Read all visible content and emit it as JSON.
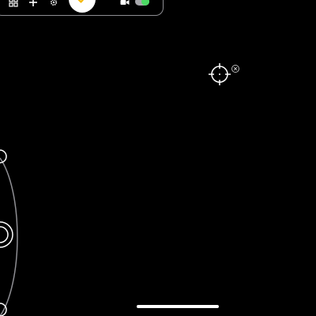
{
  "toolbar": {
    "items": [
      {
        "icon": "grid-icon"
      },
      {
        "icon": "plus-icon"
      },
      {
        "icon": "gear-icon"
      },
      {
        "icon": "checkmark-icon"
      },
      {
        "icon": "video-camera-icon"
      },
      {
        "icon": "toggle-switch"
      }
    ],
    "accent_color": "#f5b800",
    "toggle_on_color": "#4cd964",
    "toggle_on": true
  },
  "reticle": {
    "icon": "crosshair-icon",
    "close_icon": "close-icon"
  },
  "dial": {
    "icon": "circular-dial"
  },
  "colors": {
    "background": "#000000",
    "stroke": "#ffffff",
    "border": "#8e8e93"
  }
}
